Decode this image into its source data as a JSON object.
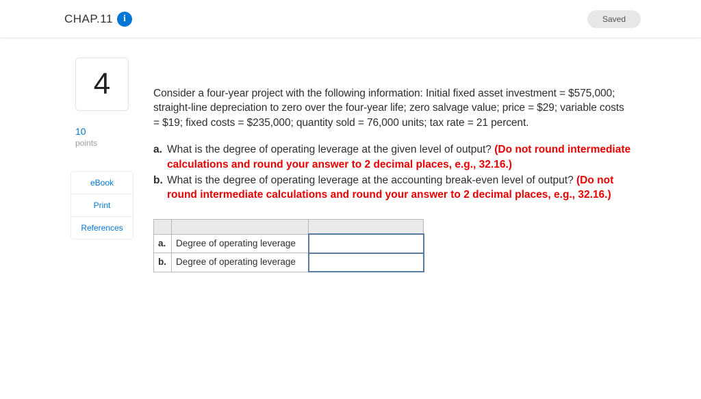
{
  "header": {
    "chapter_label": "CHAP.11",
    "info_glyph": "i",
    "saved_label": "Saved"
  },
  "question": {
    "number": "4",
    "points_value": "10",
    "points_label": "points",
    "links": {
      "ebook": "eBook",
      "print": "Print",
      "references": "References"
    },
    "prompt": "Consider a four-year project with the following information: Initial fixed asset investment = $575,000; straight-line depreciation to zero over the four-year life; zero salvage value; price = $29; variable costs = $19; fixed costs = $235,000; quantity sold = 76,000 units; tax rate = 21 percent.",
    "parts": [
      {
        "label": "a.",
        "text": "What is the degree of operating leverage at the given level of output? ",
        "instruction": "(Do not round intermediate calculations and round your answer to 2 decimal places, e.g., 32.16.)"
      },
      {
        "label": "b.",
        "text": "What is the degree of operating leverage at the accounting break-even level of output? ",
        "instruction": "(Do not round intermediate calculations and round your answer to 2 decimal places, e.g., 32.16.)"
      }
    ],
    "answer_table": {
      "rows": [
        {
          "letter": "a.",
          "desc": "Degree of operating leverage",
          "value": ""
        },
        {
          "letter": "b.",
          "desc": "Degree of operating leverage",
          "value": ""
        }
      ]
    }
  }
}
